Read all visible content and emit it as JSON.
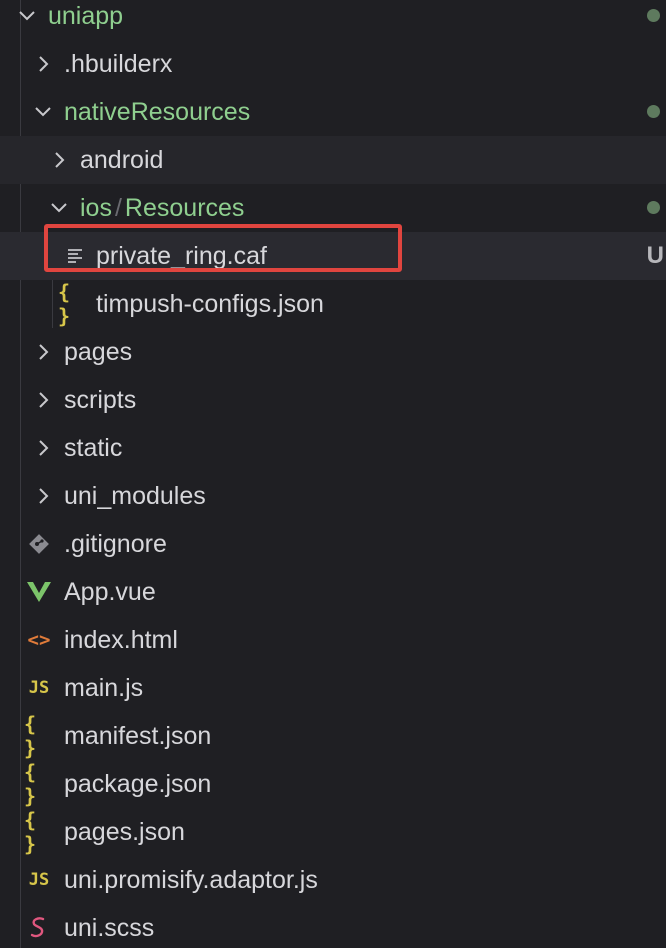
{
  "colors": {
    "background": "#1f1f23",
    "folder_text_green": "#8fcf8f",
    "text": "#d7d7db",
    "highlight_border": "#e0453f",
    "json_icon": "#d7c64a",
    "js_icon": "#d7c64a",
    "vue_icon": "#7cc46a",
    "html_icon": "#e07b3a",
    "scss_icon": "#e0577f",
    "git_icon": "#8a8a90",
    "modified_dot": "#5e7a5e"
  },
  "explorer": {
    "items": [
      {
        "name": "uniapp",
        "type": "folder",
        "expanded": true,
        "icon": "chevron-down-icon",
        "green": true,
        "dot": true
      },
      {
        "name": ".hbuilderx",
        "type": "folder",
        "expanded": false,
        "icon": "chevron-right-icon"
      },
      {
        "name": "nativeResources",
        "type": "folder",
        "expanded": true,
        "icon": "chevron-down-icon",
        "green": true,
        "dot": true
      },
      {
        "name": "android",
        "type": "folder",
        "expanded": false,
        "icon": "chevron-right-icon"
      },
      {
        "name_part1": "ios",
        "separator": "/",
        "name_part2": "Resources",
        "type": "folder",
        "expanded": true,
        "icon": "chevron-down-icon",
        "green": true,
        "dot": true
      },
      {
        "name": "private_ring.caf",
        "type": "file",
        "icon": "text-file-icon",
        "badge": "U",
        "selected": true
      },
      {
        "name": "timpush-configs.json",
        "type": "file",
        "icon": "json-icon",
        "icon_glyph": "{ }"
      },
      {
        "name": "pages",
        "type": "folder",
        "expanded": false,
        "icon": "chevron-right-icon"
      },
      {
        "name": "scripts",
        "type": "folder",
        "expanded": false,
        "icon": "chevron-right-icon"
      },
      {
        "name": "static",
        "type": "folder",
        "expanded": false,
        "icon": "chevron-right-icon"
      },
      {
        "name": "uni_modules",
        "type": "folder",
        "expanded": false,
        "icon": "chevron-right-icon"
      },
      {
        "name": ".gitignore",
        "type": "file",
        "icon": "git-icon"
      },
      {
        "name": "App.vue",
        "type": "file",
        "icon": "vue-icon"
      },
      {
        "name": "index.html",
        "type": "file",
        "icon": "html-icon",
        "icon_glyph": "<>"
      },
      {
        "name": "main.js",
        "type": "file",
        "icon": "js-icon",
        "icon_glyph": "JS"
      },
      {
        "name": "manifest.json",
        "type": "file",
        "icon": "json-icon",
        "icon_glyph": "{ }"
      },
      {
        "name": "package.json",
        "type": "file",
        "icon": "json-icon",
        "icon_glyph": "{ }"
      },
      {
        "name": "pages.json",
        "type": "file",
        "icon": "json-icon",
        "icon_glyph": "{ }"
      },
      {
        "name": "uni.promisify.adaptor.js",
        "type": "file",
        "icon": "js-icon",
        "icon_glyph": "JS"
      },
      {
        "name": "uni.scss",
        "type": "file",
        "icon": "scss-icon"
      }
    ]
  }
}
